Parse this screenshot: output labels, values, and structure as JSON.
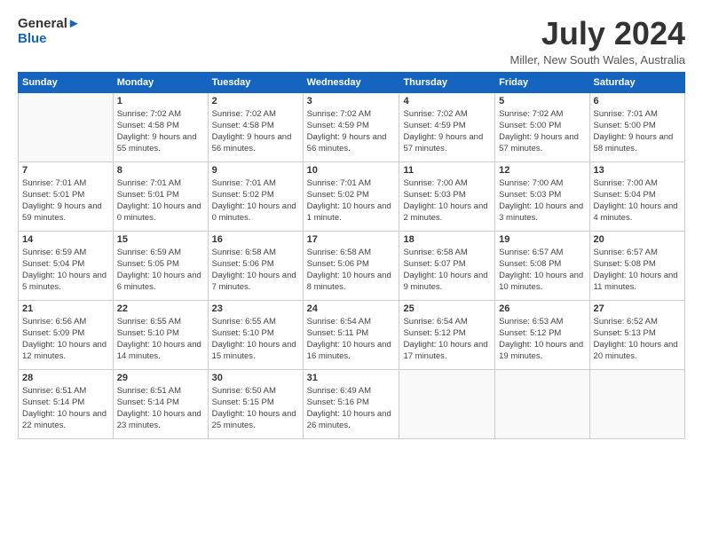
{
  "logo": {
    "line1": "General",
    "line2": "Blue"
  },
  "title": "July 2024",
  "location": "Miller, New South Wales, Australia",
  "days_header": [
    "Sunday",
    "Monday",
    "Tuesday",
    "Wednesday",
    "Thursday",
    "Friday",
    "Saturday"
  ],
  "weeks": [
    [
      {
        "num": "",
        "empty": true
      },
      {
        "num": "1",
        "rise": "7:02 AM",
        "set": "4:58 PM",
        "daylight": "9 hours and 55 minutes."
      },
      {
        "num": "2",
        "rise": "7:02 AM",
        "set": "4:58 PM",
        "daylight": "9 hours and 56 minutes."
      },
      {
        "num": "3",
        "rise": "7:02 AM",
        "set": "4:59 PM",
        "daylight": "9 hours and 56 minutes."
      },
      {
        "num": "4",
        "rise": "7:02 AM",
        "set": "4:59 PM",
        "daylight": "9 hours and 57 minutes."
      },
      {
        "num": "5",
        "rise": "7:02 AM",
        "set": "5:00 PM",
        "daylight": "9 hours and 57 minutes."
      },
      {
        "num": "6",
        "rise": "7:01 AM",
        "set": "5:00 PM",
        "daylight": "9 hours and 58 minutes."
      }
    ],
    [
      {
        "num": "7",
        "rise": "7:01 AM",
        "set": "5:01 PM",
        "daylight": "9 hours and 59 minutes."
      },
      {
        "num": "8",
        "rise": "7:01 AM",
        "set": "5:01 PM",
        "daylight": "10 hours and 0 minutes."
      },
      {
        "num": "9",
        "rise": "7:01 AM",
        "set": "5:02 PM",
        "daylight": "10 hours and 0 minutes."
      },
      {
        "num": "10",
        "rise": "7:01 AM",
        "set": "5:02 PM",
        "daylight": "10 hours and 1 minute."
      },
      {
        "num": "11",
        "rise": "7:00 AM",
        "set": "5:03 PM",
        "daylight": "10 hours and 2 minutes."
      },
      {
        "num": "12",
        "rise": "7:00 AM",
        "set": "5:03 PM",
        "daylight": "10 hours and 3 minutes."
      },
      {
        "num": "13",
        "rise": "7:00 AM",
        "set": "5:04 PM",
        "daylight": "10 hours and 4 minutes."
      }
    ],
    [
      {
        "num": "14",
        "rise": "6:59 AM",
        "set": "5:04 PM",
        "daylight": "10 hours and 5 minutes."
      },
      {
        "num": "15",
        "rise": "6:59 AM",
        "set": "5:05 PM",
        "daylight": "10 hours and 6 minutes."
      },
      {
        "num": "16",
        "rise": "6:58 AM",
        "set": "5:06 PM",
        "daylight": "10 hours and 7 minutes."
      },
      {
        "num": "17",
        "rise": "6:58 AM",
        "set": "5:06 PM",
        "daylight": "10 hours and 8 minutes."
      },
      {
        "num": "18",
        "rise": "6:58 AM",
        "set": "5:07 PM",
        "daylight": "10 hours and 9 minutes."
      },
      {
        "num": "19",
        "rise": "6:57 AM",
        "set": "5:08 PM",
        "daylight": "10 hours and 10 minutes."
      },
      {
        "num": "20",
        "rise": "6:57 AM",
        "set": "5:08 PM",
        "daylight": "10 hours and 11 minutes."
      }
    ],
    [
      {
        "num": "21",
        "rise": "6:56 AM",
        "set": "5:09 PM",
        "daylight": "10 hours and 12 minutes."
      },
      {
        "num": "22",
        "rise": "6:55 AM",
        "set": "5:10 PM",
        "daylight": "10 hours and 14 minutes."
      },
      {
        "num": "23",
        "rise": "6:55 AM",
        "set": "5:10 PM",
        "daylight": "10 hours and 15 minutes."
      },
      {
        "num": "24",
        "rise": "6:54 AM",
        "set": "5:11 PM",
        "daylight": "10 hours and 16 minutes."
      },
      {
        "num": "25",
        "rise": "6:54 AM",
        "set": "5:12 PM",
        "daylight": "10 hours and 17 minutes."
      },
      {
        "num": "26",
        "rise": "6:53 AM",
        "set": "5:12 PM",
        "daylight": "10 hours and 19 minutes."
      },
      {
        "num": "27",
        "rise": "6:52 AM",
        "set": "5:13 PM",
        "daylight": "10 hours and 20 minutes."
      }
    ],
    [
      {
        "num": "28",
        "rise": "6:51 AM",
        "set": "5:14 PM",
        "daylight": "10 hours and 22 minutes."
      },
      {
        "num": "29",
        "rise": "6:51 AM",
        "set": "5:14 PM",
        "daylight": "10 hours and 23 minutes."
      },
      {
        "num": "30",
        "rise": "6:50 AM",
        "set": "5:15 PM",
        "daylight": "10 hours and 25 minutes."
      },
      {
        "num": "31",
        "rise": "6:49 AM",
        "set": "5:16 PM",
        "daylight": "10 hours and 26 minutes."
      },
      {
        "num": "",
        "empty": true
      },
      {
        "num": "",
        "empty": true
      },
      {
        "num": "",
        "empty": true
      }
    ]
  ],
  "labels": {
    "sunrise": "Sunrise:",
    "sunset": "Sunset:",
    "daylight": "Daylight:"
  }
}
